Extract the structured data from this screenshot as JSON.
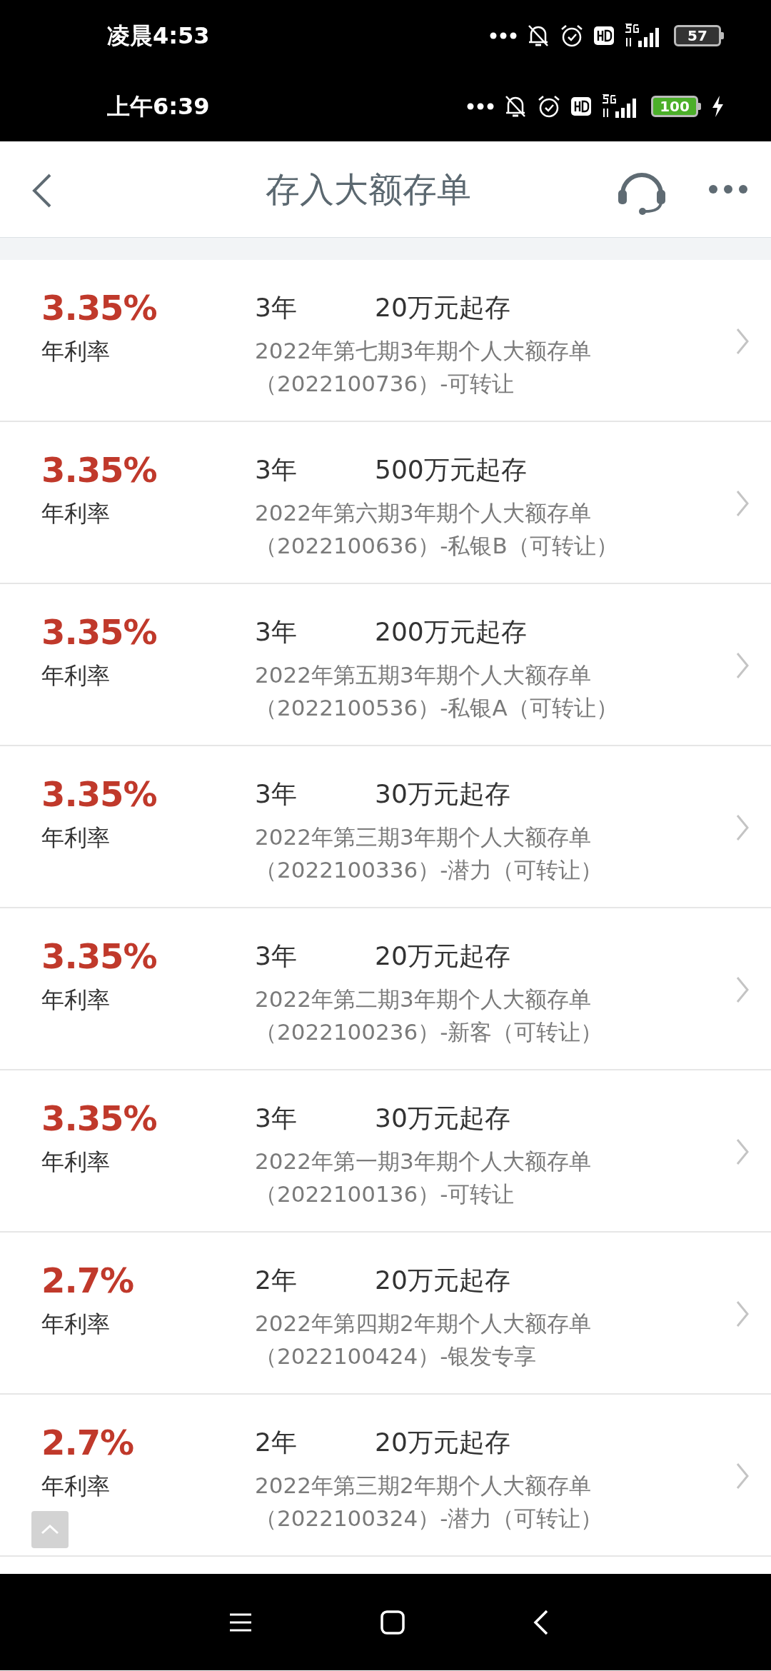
{
  "status_bars": [
    {
      "time": "凌晨4:53",
      "battery": "57",
      "charging": false
    },
    {
      "time": "上午6:39",
      "battery": "100",
      "charging": true
    }
  ],
  "header": {
    "title": "存入大额存单"
  },
  "products": [
    {
      "rate": "3.35%",
      "rate_label": "年利率",
      "term": "3年",
      "minimum": "20万元起存",
      "name": "2022年第七期3年期个人大额存单",
      "code": "（2022100736）-可转让"
    },
    {
      "rate": "3.35%",
      "rate_label": "年利率",
      "term": "3年",
      "minimum": "500万元起存",
      "name": "2022年第六期3年期个人大额存单",
      "code": "（2022100636）-私银B（可转让）"
    },
    {
      "rate": "3.35%",
      "rate_label": "年利率",
      "term": "3年",
      "minimum": "200万元起存",
      "name": "2022年第五期3年期个人大额存单",
      "code": "（2022100536）-私银A（可转让）"
    },
    {
      "rate": "3.35%",
      "rate_label": "年利率",
      "term": "3年",
      "minimum": "30万元起存",
      "name": "2022年第三期3年期个人大额存单",
      "code": "（2022100336）-潜力（可转让）"
    },
    {
      "rate": "3.35%",
      "rate_label": "年利率",
      "term": "3年",
      "minimum": "20万元起存",
      "name": "2022年第二期3年期个人大额存单",
      "code": "（2022100236）-新客（可转让）"
    },
    {
      "rate": "3.35%",
      "rate_label": "年利率",
      "term": "3年",
      "minimum": "30万元起存",
      "name": "2022年第一期3年期个人大额存单",
      "code": "（2022100136）-可转让"
    },
    {
      "rate": "2.7%",
      "rate_label": "年利率",
      "term": "2年",
      "minimum": "20万元起存",
      "name": "2022年第四期2年期个人大额存单",
      "code": "（2022100424）-银发专享"
    },
    {
      "rate": "2.7%",
      "rate_label": "年利率",
      "term": "2年",
      "minimum": "20万元起存",
      "name": "2022年第三期2年期个人大额存单",
      "code": "（2022100324）-潜力（可转让）"
    }
  ]
}
